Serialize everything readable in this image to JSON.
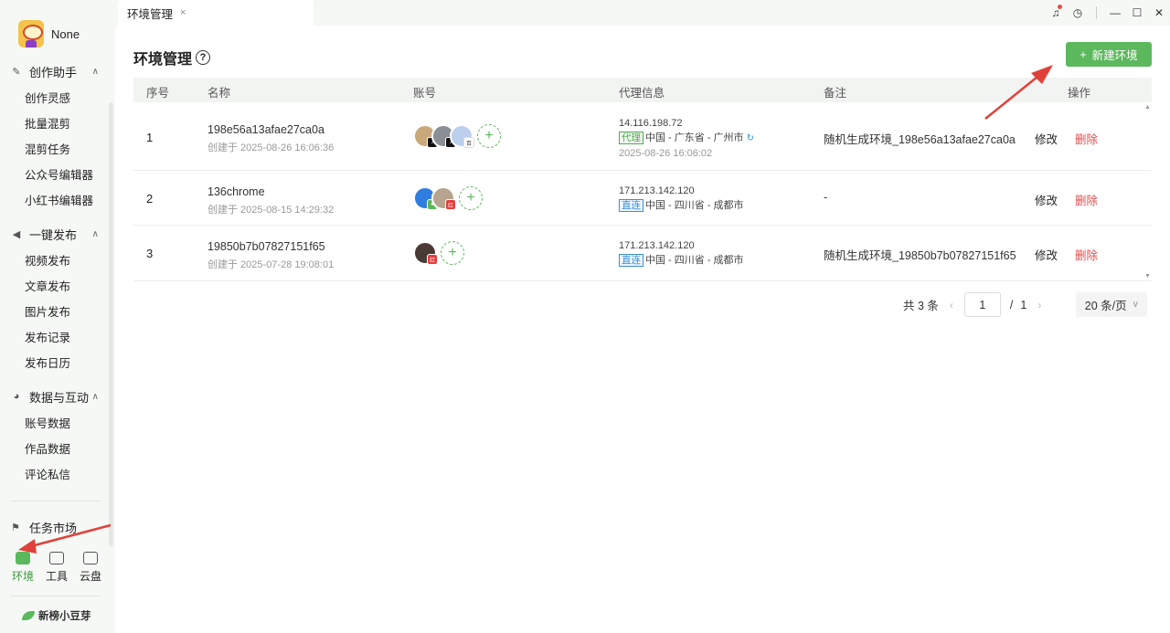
{
  "user": {
    "name": "None"
  },
  "sidebar": {
    "sections": [
      {
        "title": "创作助手",
        "icon": "pen-icon",
        "items": [
          "创作灵感",
          "批量混剪",
          "混剪任务",
          "公众号编辑器",
          "小红书编辑器"
        ]
      },
      {
        "title": "一键发布",
        "icon": "send-icon",
        "items": [
          "视频发布",
          "文章发布",
          "图片发布",
          "发布记录",
          "发布日历"
        ]
      },
      {
        "title": "数据与互动",
        "icon": "pie-chart-icon",
        "items": [
          "账号数据",
          "作品数据",
          "评论私信"
        ]
      }
    ],
    "task_market": "任务市场",
    "bottom_tabs": [
      "环境",
      "工具",
      "云盘"
    ],
    "brand": "新榜小豆芽"
  },
  "tab": {
    "label": "环境管理",
    "close": "×"
  },
  "page": {
    "title": "环境管理",
    "help": "?",
    "new_button": "新建环境",
    "columns": [
      "序号",
      "名称",
      "账号",
      "代理信息",
      "备注",
      "操作"
    ],
    "rows": [
      {
        "index": "1",
        "name": "198e56a13afae27ca0a",
        "created": "创建于 2025-08-26 16:06:36",
        "proxy_ip": "14.116.198.72",
        "proxy_tag": "代理",
        "proxy_loc": "中国 - 广东省 - 广州市",
        "proxy_time": "2025-08-26 16:06:02",
        "note": "随机生成环境_198e56a13afae27ca0a",
        "edit": "修改",
        "delete": "删除"
      },
      {
        "index": "2",
        "name": "136chrome",
        "created": "创建于 2025-08-15 14:29:32",
        "proxy_ip": "171.213.142.120",
        "proxy_tag": "直连",
        "proxy_loc": "中国 - 四川省 - 成都市",
        "note": "-",
        "edit": "修改",
        "delete": "删除"
      },
      {
        "index": "3",
        "name": "19850b7b07827151f65",
        "created": "创建于 2025-07-28 19:08:01",
        "proxy_ip": "171.213.142.120",
        "proxy_tag": "直连",
        "proxy_loc": "中国 - 四川省 - 成都市",
        "note": "随机生成环境_19850b7b07827151f65",
        "edit": "修改",
        "delete": "删除"
      }
    ],
    "pagination": {
      "total": "共 3 条",
      "current": "1",
      "sep": "/",
      "pages": "1",
      "page_size": "20 条/页"
    }
  },
  "colors": {
    "accent": "#5cb85c",
    "danger": "#e14b4b",
    "link_blue": "#3a8ed6",
    "annotation": "#e0413a"
  }
}
